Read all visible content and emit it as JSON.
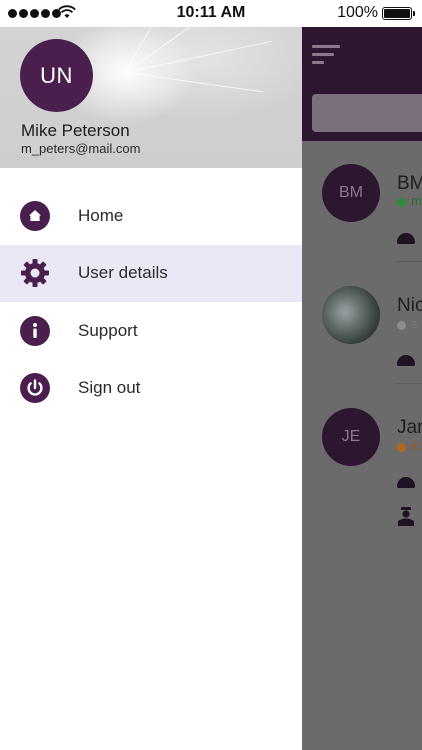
{
  "status_bar": {
    "time": "10:11 AM",
    "battery": "100%"
  },
  "drawer": {
    "avatar_initials": "UN",
    "user_name": "Mike Peterson",
    "user_email": "m_peters@mail.com",
    "items": [
      {
        "label": "Home",
        "icon": "home-icon",
        "active": false
      },
      {
        "label": "User details",
        "icon": "gear-icon",
        "active": true
      },
      {
        "label": "Support",
        "icon": "info-icon",
        "active": false
      },
      {
        "label": "Sign out",
        "icon": "power-icon",
        "active": false
      }
    ]
  },
  "background_list": {
    "items": [
      {
        "initials": "BM",
        "name": "BM",
        "status": "m",
        "status_color": "#2e8b3a"
      },
      {
        "initials": "",
        "name": "Nic",
        "status": "s",
        "status_color": "#8c8c8c"
      },
      {
        "initials": "JE",
        "name": "Jan",
        "status": "ic",
        "status_color": "#b5651d"
      }
    ]
  },
  "colors": {
    "accent": "#4a1f4e",
    "active_item_bg": "#e9e8f4",
    "overlay": "#6b6b6b"
  }
}
